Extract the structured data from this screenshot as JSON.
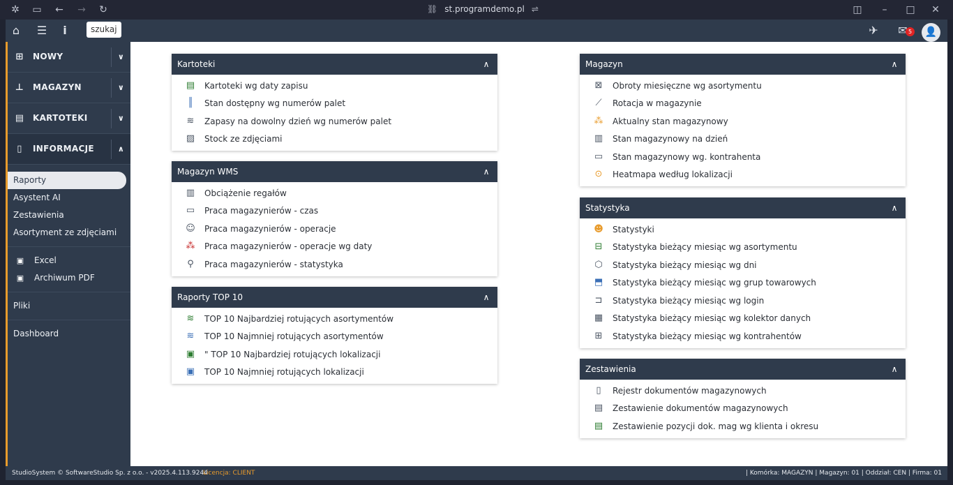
{
  "browser": {
    "url": "st.programdemo.pl"
  },
  "topbar": {
    "search_label": "szukaj",
    "notifications_count": "5"
  },
  "sidebar": {
    "menu": [
      {
        "label": "NOWY",
        "icon": "plus-square-icon"
      },
      {
        "label": "MAGAZYN",
        "icon": "warehouse-icon"
      },
      {
        "label": "KARTOTEKI",
        "icon": "newspaper-icon"
      },
      {
        "label": "INFORMACJE",
        "icon": "document-icon"
      }
    ],
    "sub_items": [
      "Raporty",
      "Asystent AI",
      "Zestawienia",
      "Asortyment ze zdjęciami"
    ],
    "file_items": [
      "Excel",
      "Archiwum PDF"
    ],
    "extra_items": [
      "Pliki",
      "Dashboard"
    ]
  },
  "cards": {
    "kartoteki": {
      "title": "Kartoteki",
      "items": [
        "Kartoteki wg daty zapisu",
        "Stan dostępny wg numerów palet",
        "Zapasy na dowolny dzień wg numerów palet",
        "Stock ze zdjęciami"
      ]
    },
    "wms": {
      "title": "Magazyn WMS",
      "items": [
        "Obciążenie regałów",
        "Praca magazynierów - czas",
        "Praca magazynierów - operacje",
        "Praca magazynierów - operacje wg daty",
        "Praca magazynierów - statystyka"
      ]
    },
    "top10": {
      "title": "Raporty TOP 10",
      "items": [
        "TOP 10 Najbardziej rotujących asortymentów",
        "TOP 10 Najmniej rotujących asortymentów",
        "\" TOP 10 Najbardziej rotujących lokalizacji",
        "TOP 10 Najmniej rotujących lokalizacji"
      ]
    },
    "magazyn": {
      "title": "Magazyn",
      "items": [
        "Obroty miesięczne wg asortymentu",
        "Rotacja w magazynie",
        "Aktualny stan magazynowy",
        "Stan magazynowy na dzień",
        "Stan magazynowy wg. kontrahenta",
        "Heatmapa według lokalizacji"
      ]
    },
    "statystyka": {
      "title": "Statystyka",
      "items": [
        "Statystyki",
        "Statystyka bieżący miesiąc wg asortymentu",
        "Statystyka bieżący miesiąc wg dni",
        "Statystyka bieżący miesiąc wg grup towarowych",
        "Statystyka bieżący miesiąc wg login",
        "Statystyka bieżący miesiąc wg kolektor danych",
        "Statystyka bieżący miesiąc wg kontrahentów"
      ]
    },
    "zestawienia": {
      "title": "Zestawienia",
      "items": [
        "Rejestr dokumentów magazynowych",
        "Zestawienie dokumentów magazynowych",
        "Zestawienie pozycji dok. mag wg klienta i okresu"
      ]
    }
  },
  "footer": {
    "copyright": "StudioSystem © SoftwareStudio Sp. z o.o. - v2025.4.113.9244",
    "license": "Licencja: CLIENT",
    "status": "| Komórka: MAGAZYN | Magazyn: 01 | Oddział: CEN | Firma: 01"
  },
  "colors": {
    "navy": "#2f3b4c",
    "accent_orange": "#e89b2c",
    "badge_red": "#e02424"
  }
}
